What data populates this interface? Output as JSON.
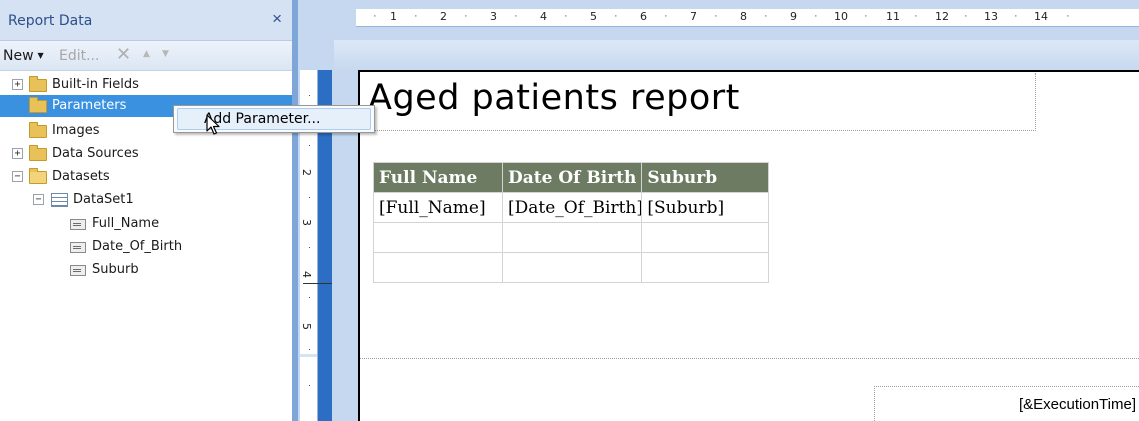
{
  "panel": {
    "title": "Report Data",
    "close_glyph": "×",
    "toolbar": {
      "new_label": "New",
      "edit_label": "Edit...",
      "delete_glyph": "✕",
      "up_glyph": "⇧",
      "down_glyph": "⇩"
    },
    "tree": {
      "built_in_fields": "Built-in Fields",
      "parameters": "Parameters",
      "images": "Images",
      "data_sources": "Data Sources",
      "datasets": "Datasets",
      "dataset1": "DataSet1",
      "fields": [
        "Full_Name",
        "Date_Of_Birth",
        "Suburb"
      ],
      "collapsed_glyph": "+",
      "expanded_glyph": "−"
    }
  },
  "context_menu": {
    "add_parameter": "Add Parameter..."
  },
  "rulers": {
    "horizontal": [
      "1",
      "2",
      "3",
      "4",
      "5",
      "6",
      "7",
      "8",
      "9",
      "10",
      "11",
      "12",
      "13",
      "14"
    ],
    "vertical": [
      "2",
      "3",
      "4",
      "5"
    ],
    "dot": "·"
  },
  "report": {
    "title": "Aged patients report",
    "table": {
      "headers": [
        "Full Name",
        "Date Of Birth",
        "Suburb"
      ],
      "row1": [
        "[Full_Name]",
        "[Date_Of_Birth]",
        "[Suburb]"
      ]
    },
    "footer_text": "[&ExecutionTime]"
  },
  "colors": {
    "header_fill": "#6d7b63",
    "selection": "#3a91e0",
    "panel_header": "#d5e2f3"
  }
}
